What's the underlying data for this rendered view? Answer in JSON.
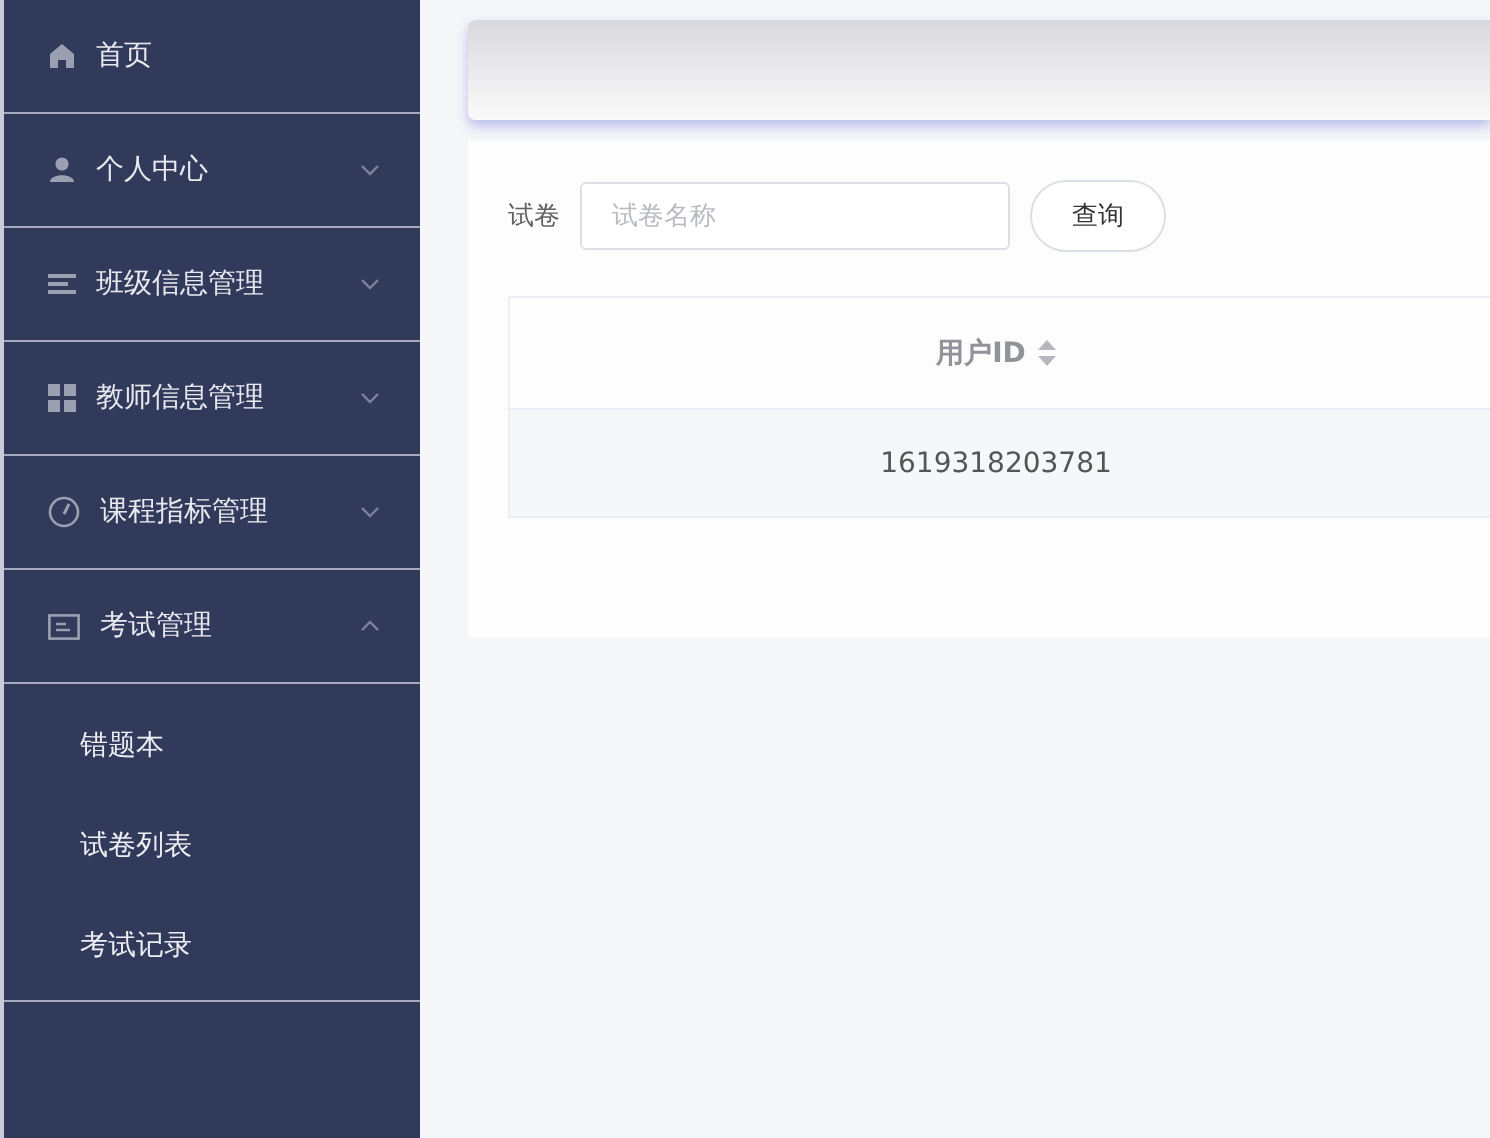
{
  "sidebar": {
    "items": [
      {
        "label": "首页",
        "kind": "link"
      },
      {
        "label": "个人中心",
        "kind": "submenu",
        "expanded": false
      },
      {
        "label": "班级信息管理",
        "kind": "submenu",
        "expanded": false
      },
      {
        "label": "教师信息管理",
        "kind": "submenu",
        "expanded": false
      },
      {
        "label": "课程指标管理",
        "kind": "submenu",
        "expanded": false
      },
      {
        "label": "考试管理",
        "kind": "submenu",
        "expanded": true,
        "children": [
          {
            "label": "错题本"
          },
          {
            "label": "试卷列表"
          },
          {
            "label": "考试记录"
          }
        ]
      }
    ]
  },
  "search": {
    "label": "试卷",
    "placeholder": "试卷名称",
    "button": "查询"
  },
  "table": {
    "columns": [
      {
        "label": "用户ID",
        "sortable": true
      }
    ],
    "rows": [
      [
        "1619318203781"
      ]
    ]
  }
}
